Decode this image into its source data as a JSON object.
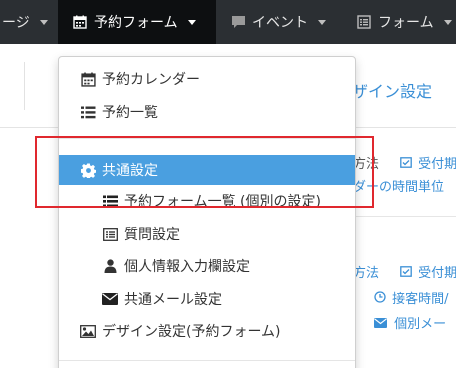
{
  "navbar": {
    "items": [
      {
        "label": "ージ",
        "icon": null,
        "active": false
      },
      {
        "label": "予約フォーム",
        "icon": "calendar-icon",
        "active": true
      },
      {
        "label": "イベント",
        "icon": "comment-icon",
        "active": false
      },
      {
        "label": "フォーム",
        "icon": "list-alt-icon",
        "active": false
      }
    ]
  },
  "background": {
    "title": "ザイン設定",
    "row1": {
      "method": "方法",
      "accept": "受付期"
    },
    "row1_sub": "ダーの時間単位",
    "row2": {
      "method": "方法",
      "accept": "受付期"
    },
    "row2_time": "接客時間/",
    "row2_mail": "個別メー"
  },
  "dropdown": {
    "items": [
      {
        "label": "予約カレンダー",
        "icon": "calendar-icon"
      },
      {
        "label": "予約一覧",
        "icon": "list-icon"
      },
      {
        "label": "共通設定",
        "icon": "gear-icon",
        "active": true
      },
      {
        "label": "予約フォーム一覧 (個別の設定)",
        "icon": "th-list-icon"
      },
      {
        "label": "質問設定",
        "icon": "list-alt-icon"
      },
      {
        "label": "個人情報入力欄設定",
        "icon": "user-icon"
      },
      {
        "label": "共通メール設定",
        "icon": "envelope-icon"
      },
      {
        "label": "デザイン設定(予約フォーム)",
        "icon": "picture-icon"
      }
    ]
  },
  "colors": {
    "navbar": "#2b2f33",
    "active_nav": "#0d0f11",
    "accent": "#4a9fe0",
    "highlight": "#e0282e"
  }
}
